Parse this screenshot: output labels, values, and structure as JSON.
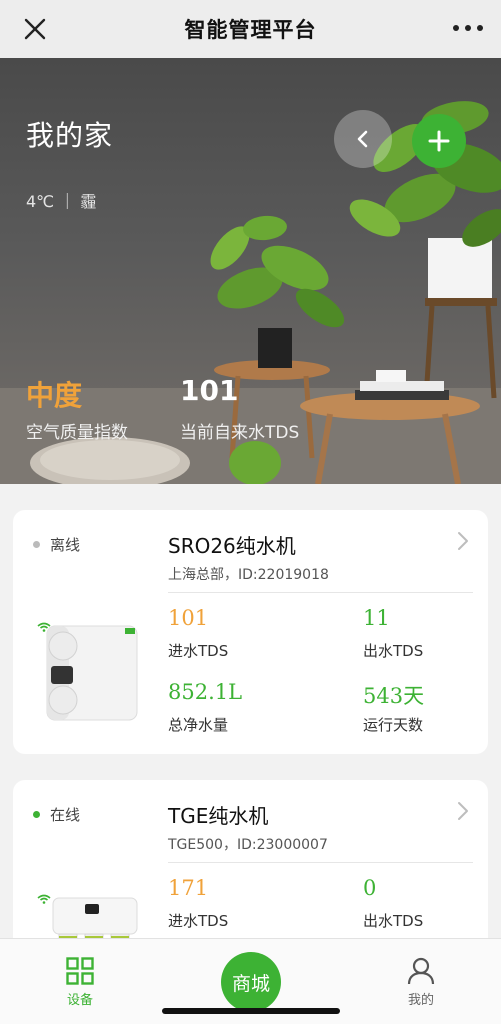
{
  "navbar": {
    "title": "智能管理平台",
    "close_icon": "close-icon",
    "more_icon": "more-horizontal-icon"
  },
  "hero": {
    "title": "我的家",
    "weather": "4℃ ｜ 霾",
    "air_quality_value": "中度",
    "air_quality_label": "空气质量指数",
    "tds_value": "101",
    "tds_label": "当前自来水TDS"
  },
  "devices": [
    {
      "status": "离线",
      "status_color": "#bbbbbb",
      "name": "SRO26纯水机",
      "subtitle": "上海总部，ID:22019018",
      "metrics": [
        {
          "value": "101",
          "label": "进水TDS"
        },
        {
          "value": "11",
          "label": "出水TDS"
        },
        {
          "value": "852.1L",
          "label": "总净水量"
        },
        {
          "value": "543天",
          "label": "运行天数"
        }
      ]
    },
    {
      "status": "在线",
      "status_color": "#3db234",
      "name": "TGE纯水机",
      "subtitle": "TGE500，ID:23000007",
      "metrics": [
        {
          "value": "171",
          "label": "进水TDS"
        },
        {
          "value": "0",
          "label": "出水TDS"
        }
      ]
    }
  ],
  "tabbar": {
    "devices_label": "设备",
    "shop_label": "商城",
    "mine_label": "我的"
  },
  "colors": {
    "accent_green": "#3db234",
    "accent_orange": "#f0a23a"
  }
}
